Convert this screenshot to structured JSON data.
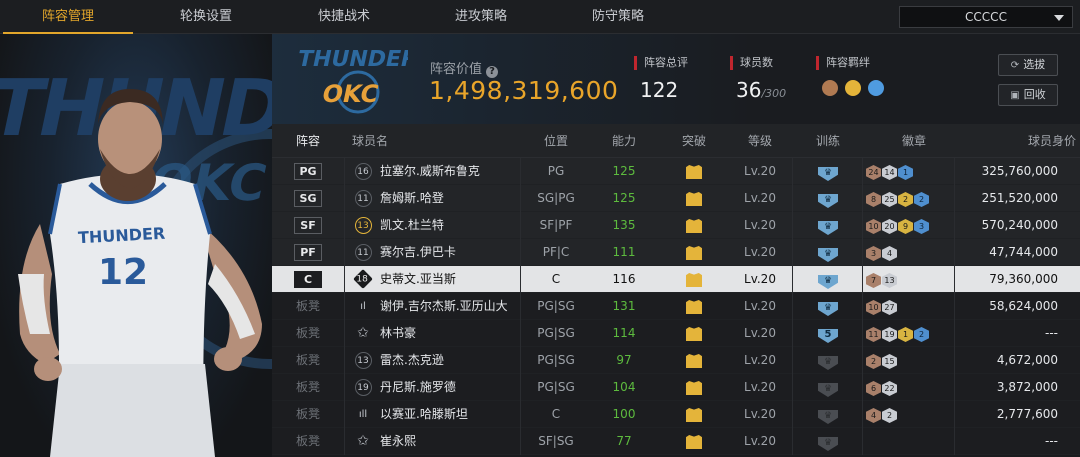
{
  "nav": {
    "tabs": [
      {
        "label": "阵容管理",
        "active": true
      },
      {
        "label": "轮换设置",
        "active": false
      },
      {
        "label": "快捷战术",
        "active": false
      },
      {
        "label": "进攻策略",
        "active": false
      },
      {
        "label": "防守策略",
        "active": false
      }
    ],
    "team_select_value": "CCCCC"
  },
  "header": {
    "value_label": "阵容价值",
    "value_number": "1,498,319,600",
    "overall_label": "阵容总评",
    "overall_value": "122",
    "players_label": "球员数",
    "players_value": "36",
    "players_max": "/300",
    "chem_label": "阵容羁绊",
    "btn_select": "选拔",
    "btn_recycle": "回收"
  },
  "table": {
    "headers": {
      "lineup": "阵容",
      "name": "球员名",
      "position": "位置",
      "ability": "能力",
      "breakthrough": "突破",
      "level": "等级",
      "training": "训练",
      "badges": "徽章",
      "value": "球员身价"
    },
    "rows": [
      {
        "slot": "PG",
        "slot_type": "starter",
        "jersey": "16",
        "jersey_style": "circle",
        "name": "拉塞尔.威斯布鲁克",
        "pos": "PG",
        "ability": "125",
        "level": "Lv.20",
        "train": "icon",
        "badges": [
          [
            "24",
            "bronze"
          ],
          [
            "14",
            "silver"
          ],
          [
            "1",
            "blue"
          ]
        ],
        "value": "325,760,000"
      },
      {
        "slot": "SG",
        "slot_type": "starter",
        "jersey": "11",
        "jersey_style": "circle",
        "name": "詹姆斯.哈登",
        "pos": "SG|PG",
        "ability": "125",
        "level": "Lv.20",
        "train": "icon",
        "badges": [
          [
            "8",
            "bronze"
          ],
          [
            "25",
            "silver"
          ],
          [
            "2",
            "gold"
          ],
          [
            "2",
            "blue"
          ]
        ],
        "value": "251,520,000"
      },
      {
        "slot": "SF",
        "slot_type": "starter",
        "jersey": "13",
        "jersey_style": "gold",
        "name": "凯文.杜兰特",
        "pos": "SF|PF",
        "ability": "135",
        "level": "Lv.20",
        "train": "icon",
        "badges": [
          [
            "10",
            "bronze"
          ],
          [
            "20",
            "silver"
          ],
          [
            "9",
            "gold"
          ],
          [
            "3",
            "blue"
          ]
        ],
        "value": "570,240,000"
      },
      {
        "slot": "PF",
        "slot_type": "starter",
        "jersey": "11",
        "jersey_style": "circle",
        "name": "赛尔吉.伊巴卡",
        "pos": "PF|C",
        "ability": "111",
        "level": "Lv.20",
        "train": "icon",
        "badges": [
          [
            "3",
            "bronze"
          ],
          [
            "4",
            "silver"
          ]
        ],
        "value": "47,744,000"
      },
      {
        "slot": "C",
        "slot_type": "selected",
        "jersey": "18",
        "jersey_style": "diamond",
        "name": "史蒂文.亚当斯",
        "pos": "C",
        "ability": "116",
        "level": "Lv.20",
        "train": "icon",
        "badges": [
          [
            "7",
            "bronze"
          ],
          [
            "13",
            "silver"
          ]
        ],
        "value": "79,360,000"
      },
      {
        "slot": "板凳",
        "slot_type": "bench",
        "jersey": "ıl",
        "jersey_style": "bars",
        "name": "谢伊.吉尔杰斯.亚历山大",
        "pos": "PG|SG",
        "ability": "131",
        "level": "Lv.20",
        "train": "icon",
        "badges": [
          [
            "10",
            "bronze"
          ],
          [
            "27",
            "silver"
          ]
        ],
        "value": "58,624,000"
      },
      {
        "slot": "板凳",
        "slot_type": "bench",
        "jersey": "✩",
        "jersey_style": "star",
        "name": "林书豪",
        "pos": "PG|SG",
        "ability": "114",
        "level": "Lv.20",
        "train": "5",
        "badges": [
          [
            "11",
            "bronze"
          ],
          [
            "19",
            "silver"
          ],
          [
            "1",
            "gold"
          ],
          [
            "2",
            "blue"
          ]
        ],
        "value": "---"
      },
      {
        "slot": "板凳",
        "slot_type": "bench",
        "jersey": "13",
        "jersey_style": "circle",
        "name": "雷杰.杰克逊",
        "pos": "PG|SG",
        "ability": "97",
        "level": "Lv.20",
        "train": "gray",
        "badges": [
          [
            "2",
            "bronze"
          ],
          [
            "15",
            "silver"
          ]
        ],
        "value": "4,672,000"
      },
      {
        "slot": "板凳",
        "slot_type": "bench",
        "jersey": "19",
        "jersey_style": "circle",
        "name": "丹尼斯.施罗德",
        "pos": "PG|SG",
        "ability": "104",
        "level": "Lv.20",
        "train": "gray",
        "badges": [
          [
            "6",
            "bronze"
          ],
          [
            "22",
            "silver"
          ]
        ],
        "value": "3,872,000"
      },
      {
        "slot": "板凳",
        "slot_type": "bench",
        "jersey": "ıll",
        "jersey_style": "bars",
        "name": "以赛亚.哈滕斯坦",
        "pos": "C",
        "ability": "100",
        "level": "Lv.20",
        "train": "gray",
        "badges": [
          [
            "4",
            "bronze"
          ],
          [
            "2",
            "silver"
          ]
        ],
        "value": "2,777,600"
      },
      {
        "slot": "板凳",
        "slot_type": "bench",
        "jersey": "✩",
        "jersey_style": "star",
        "name": "崔永熙",
        "pos": "SF|SG",
        "ability": "77",
        "level": "Lv.20",
        "train": "gray",
        "badges": [],
        "value": "---"
      }
    ]
  },
  "hero": {
    "jersey_team": "THUNDER",
    "jersey_number": "12",
    "bg_word": "THUNDER",
    "bg_okc": "OKC"
  },
  "colors": {
    "accent": "#e2a62b",
    "ability_green": "#5dbb3e",
    "stat_red": "#c0262e"
  }
}
